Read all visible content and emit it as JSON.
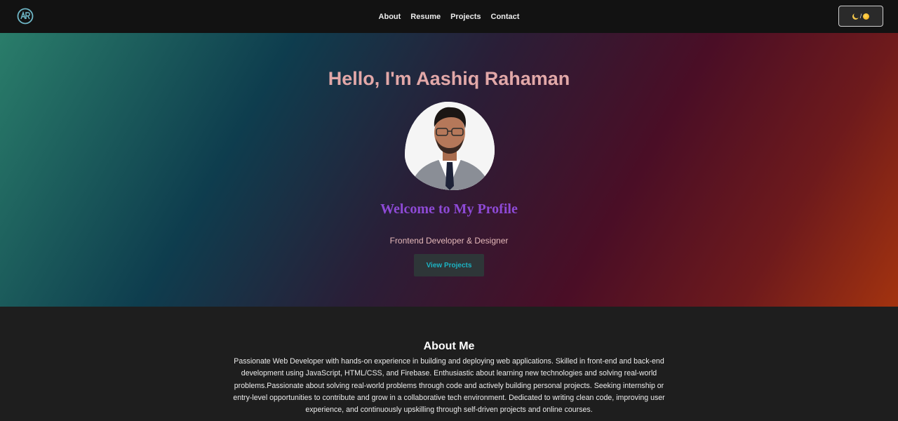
{
  "nav": {
    "logo_icon": "ar-monogram-icon",
    "links": [
      "About",
      "Resume",
      "Projects",
      "Contact"
    ],
    "theme_toggle": {
      "separator": "/",
      "icons": [
        "moon-icon",
        "sun-icon"
      ]
    }
  },
  "hero": {
    "title": "Hello, I'm Aashiq Rahaman",
    "subtitle": "Welcome to My Profile",
    "role": "Frontend Developer & Designer",
    "cta_label": "View Projects",
    "colors": {
      "title": "#e2a8a8",
      "subtitle": "#8e4ad6",
      "cta_text": "#1cb4c4"
    }
  },
  "about": {
    "title": "About Me",
    "text": "Passionate Web Developer with hands-on experience in building and deploying web applications. Skilled in front-end and back-end development using JavaScript, HTML/CSS, and Firebase. Enthusiastic about learning new technologies and solving real-world problems.Passionate about solving real-world problems through code and actively building personal projects. Seeking internship or entry-level opportunities to contribute and grow in a collaborative tech environment. Dedicated to writing clean code, improving user experience, and continuously upskilling through self-driven projects and online courses."
  }
}
